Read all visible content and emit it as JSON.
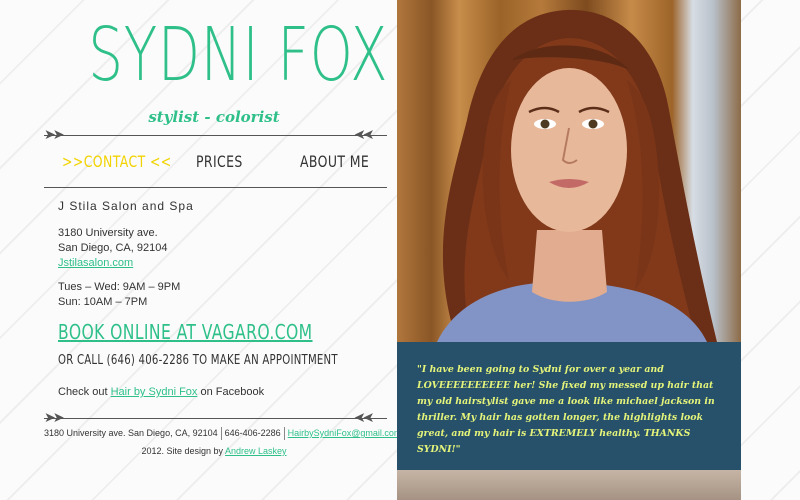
{
  "header": {
    "title": "SYDNI FOX",
    "tagline": "stylist - colorist"
  },
  "nav": {
    "contact": ">>CONTACT <<",
    "prices": "PRICES",
    "about": "ABOUT ME"
  },
  "contact": {
    "salon_name": "J Stila Salon and Spa",
    "address_line1": "3180 University ave.",
    "address_line2": "San Diego, CA, 92104",
    "website": "Jstilasalon.com",
    "hours_line1": "Tues – Wed: 9AM – 9PM",
    "hours_line2": "Sun: 10AM – 7PM",
    "book_online": "BOOK ONLINE AT VAGARO.COM",
    "call": "OR CALL (646) 406-2286 TO MAKE AN APPOINTMENT",
    "fb_prefix": "Check out",
    "fb_link": "Hair by Sydni Fox",
    "fb_suffix": "on Facebook"
  },
  "footer": {
    "address": "3180 University ave. San Diego, CA, 92104",
    "phone": "646-406-2286",
    "email": "HairbySydniFox@gmail.com",
    "credit_prefix": "2012. Site design by",
    "credit_link": "Andrew Laskey"
  },
  "testimonial": {
    "quote": "\"I have been going to Sydni for over a year and LOVEEEEEEEEEE her! She fixed my messed up hair that my old hairstylist gave me a look like michael jackson in thriller. My hair has gotten longer, the highlights look great, and my hair is EXTREMELY healthy. THANKS SYDNI!\""
  },
  "colors": {
    "accent_green": "#2fc08a",
    "nav_active": "#f2d300",
    "quote_bg": "#27506a",
    "quote_text": "#e4f47a"
  }
}
